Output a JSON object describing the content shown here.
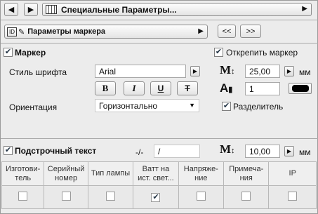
{
  "header": {
    "title": "Специальные Параметры..."
  },
  "marker_bar": {
    "dropdown_label": "Параметры маркера",
    "prev_label": "<<",
    "next_label": ">>"
  },
  "marker": {
    "checkbox_label": "Маркер",
    "checked": true,
    "font_style_label": "Стиль шрифта",
    "font_value": "Arial",
    "bold_label": "B",
    "italic_label": "I",
    "underline_label": "U",
    "strike_label": "T",
    "orientation_label": "Ориентация",
    "orientation_value": "Горизонтально",
    "detach_label": "Открепить маркер",
    "detach_checked": true,
    "size_value": "25,00",
    "size_unit": "мм",
    "pen_value": "1",
    "separator_label": "Разделитель",
    "separator_checked": true
  },
  "subtext": {
    "checkbox_label": "Подстрочный текст",
    "checked": true,
    "separator_prefix": "-/-",
    "separator_value": "/",
    "size_value": "10,00",
    "size_unit": "мм"
  },
  "table": {
    "columns": [
      "Изготови-\nтель",
      "Серийный\nномер",
      "Тип лампы",
      "Ватт на\nист. свет...",
      "Напряже-\nние",
      "Примеча-\nния",
      "IP"
    ],
    "checked": [
      false,
      false,
      false,
      true,
      false,
      false,
      false
    ]
  },
  "colors": {
    "panel_bg": "#ececec",
    "border": "#9a9a9a"
  }
}
